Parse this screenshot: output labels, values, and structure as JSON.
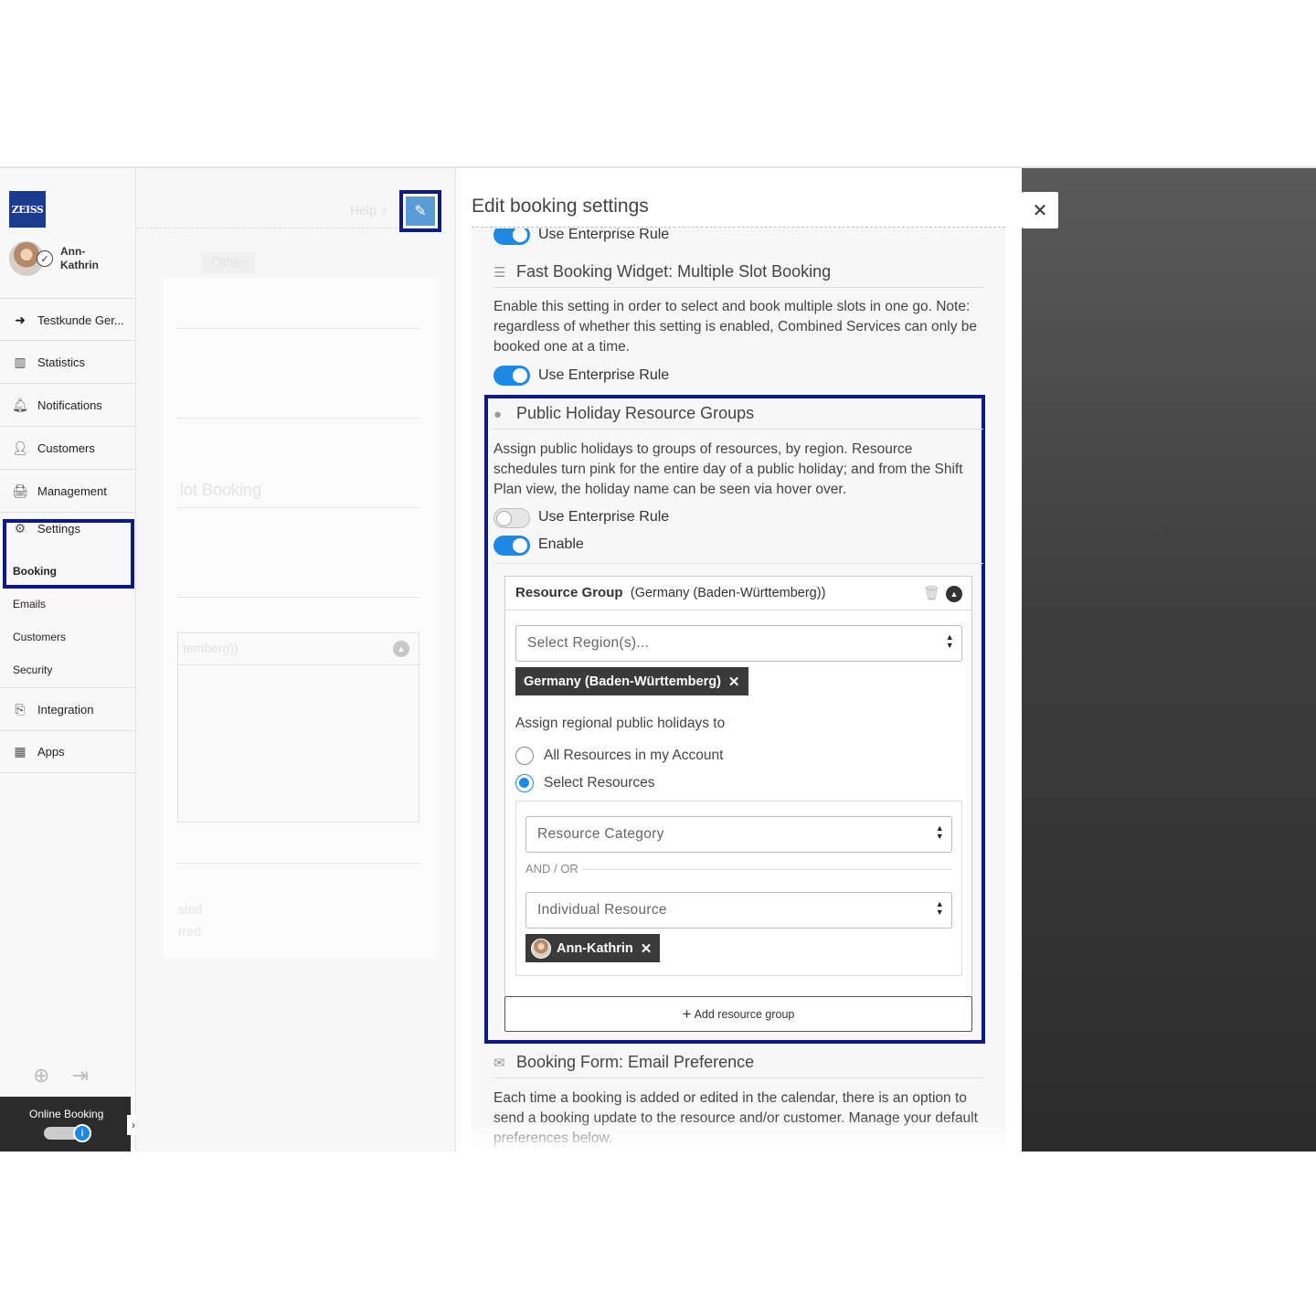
{
  "sidebar": {
    "logo": "ZEISS",
    "user_name": "Ann-Kathrin",
    "nav": [
      {
        "icon": "back-circle-icon",
        "glyph": "➜",
        "label": "Testkunde Ger..."
      },
      {
        "icon": "bar-chart-icon",
        "glyph": "▥",
        "label": "Statistics"
      },
      {
        "icon": "bell-icon",
        "glyph": "🔔︎",
        "label": "Notifications"
      },
      {
        "icon": "person-icon",
        "glyph": "👤︎",
        "label": "Customers"
      },
      {
        "icon": "briefcase-icon",
        "glyph": "🖨︎",
        "label": "Management"
      },
      {
        "icon": "gears-icon",
        "glyph": "⚙",
        "label": "Settings"
      }
    ],
    "settings_sub": [
      "Booking",
      "Emails",
      "Customers",
      "Security"
    ],
    "nav_after": [
      {
        "icon": "integration-icon",
        "glyph": "⎘",
        "label": "Integration"
      },
      {
        "icon": "grid-icon",
        "glyph": "▦",
        "label": "Apps"
      }
    ],
    "online_booking_label": "Online Booking",
    "online_booking_info": "i"
  },
  "background": {
    "help_label": "Help",
    "other_label": "Other",
    "slot_booking_fragment": "lot Booking",
    "region_fragment": "temberg))",
    "frag_1": "sted",
    "frag_2": "rred"
  },
  "modal": {
    "title": "Edit booking settings",
    "top_toggle_label": "Use Enterprise Rule",
    "fast_booking": {
      "title": "Fast Booking Widget: Multiple Slot Booking",
      "description": "Enable this setting in order to select and book multiple slots in one go. Note: regardless of whether this setting is enabled, Combined Services can only be booked one at a time.",
      "toggle_label": "Use Enterprise Rule"
    },
    "holiday": {
      "title": "Public Holiday Resource Groups",
      "description": "Assign public holidays to groups of resources, by region. Resource schedules turn pink for the entire day of a public holiday; and from the Shift Plan view, the holiday name can be seen via hover over.",
      "enterprise_label": "Use Enterprise Rule",
      "enable_label": "Enable",
      "group": {
        "header_label": "Resource Group",
        "header_region": "(Germany (Baden-Württemberg))",
        "region_placeholder": "Select Region(s)...",
        "region_chip": "Germany (Baden-Württemberg)",
        "assign_label": "Assign regional public holidays to",
        "option_all": "All Resources in my Account",
        "option_select": "Select Resources",
        "category_placeholder": "Resource Category",
        "and_or": "AND / OR",
        "individual_placeholder": "Individual Resource",
        "resource_chip": "Ann-Kathrin"
      },
      "add_group_label": "Add resource group"
    },
    "email_pref": {
      "title": "Booking Form: Email Preference",
      "description": "Each time a booking is added or edited in the calendar, there is an option to send a booking update to the resource and/or customer. Manage your default preferences below."
    }
  },
  "colors": {
    "accent": "#1e88e5",
    "highlight": "#0d1a80",
    "chip": "#3a3a3a"
  }
}
